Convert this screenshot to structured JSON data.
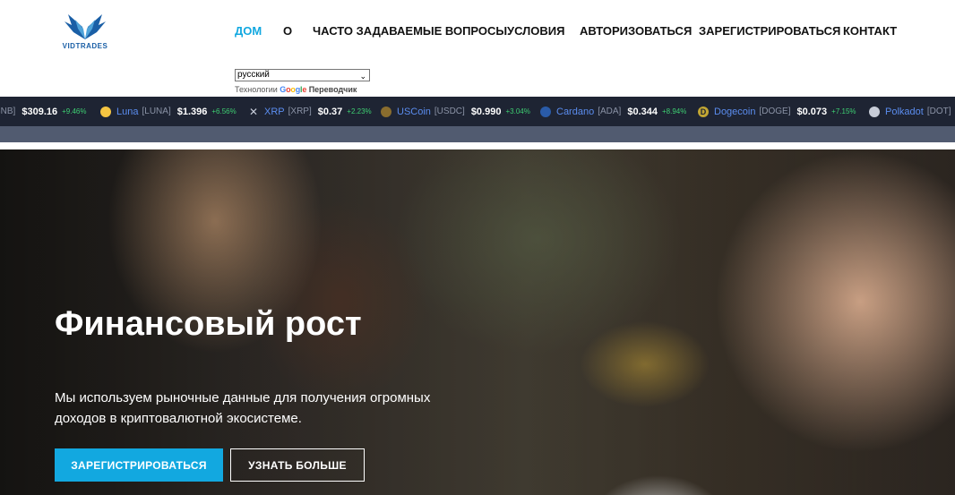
{
  "logo": {
    "text": "VIDTRADES",
    "brand_color": "#1a5fa6"
  },
  "nav": {
    "items": [
      {
        "label": "ДОМ",
        "active": true
      },
      {
        "label": "О",
        "active": false
      },
      {
        "label": "ЧАСТО ЗАДАВАЕМЫЕ ВОПРОСЫ",
        "active": false
      },
      {
        "label": "УСЛОВИЯ",
        "active": false
      },
      {
        "label": "АВТОРИЗОВАТЬСЯ",
        "active": false
      },
      {
        "label": "ЗАРЕГИСТРИРОВАТЬСЯ",
        "active": false
      },
      {
        "label": "КОНТАКТ",
        "active": false
      }
    ],
    "active_color": "#12a8e0"
  },
  "translate": {
    "selected_language": "русский",
    "powered_prefix": "Технологии",
    "google": "Google",
    "service": "Переводчик"
  },
  "ticker": [
    {
      "name": "",
      "symbol": "BNB]",
      "price": "$309.16",
      "change": "+9.46%"
    },
    {
      "name": "Luna",
      "symbol": "[LUNA]",
      "price": "$1.396",
      "change": "+6.56%",
      "icon": "luna-icon"
    },
    {
      "name": "XRP",
      "symbol": "[XRP]",
      "price": "$0.37",
      "change": "+2.23%",
      "icon": "xrp-icon"
    },
    {
      "name": "USCoin",
      "symbol": "[USDC]",
      "price": "$0.990",
      "change": "+3.04%",
      "icon": "usdc-icon"
    },
    {
      "name": "Cardano",
      "symbol": "[ADA]",
      "price": "$0.344",
      "change": "+8.94%",
      "icon": "cardano-icon"
    },
    {
      "name": "Dogecoin",
      "symbol": "[DOGE]",
      "price": "$0.073",
      "change": "+7.15%",
      "icon": "dogecoin-icon"
    },
    {
      "name": "Polkadot",
      "symbol": "[DOT]",
      "price": "",
      "change": "",
      "icon": "polkadot-icon"
    }
  ],
  "hero": {
    "title": "Финансовый рост",
    "description": "Мы используем рыночные данные для получения огромных доходов в криптовалютной экосистеме.",
    "primary_button": "ЗАРЕГИСТРИРОВАТЬСЯ",
    "secondary_button": "УЗНАТЬ БОЛЬШЕ"
  }
}
